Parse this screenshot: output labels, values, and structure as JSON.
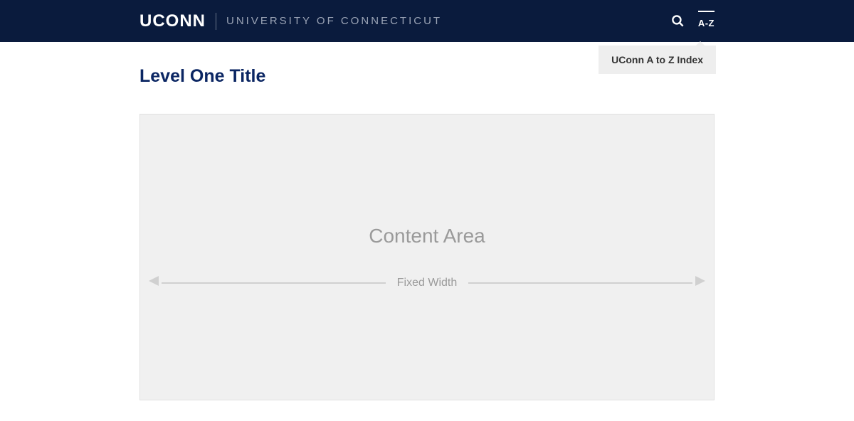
{
  "header": {
    "logo": "UCONN",
    "university_name": "UNIVERSITY OF CONNECTICUT",
    "az_label": "A-Z"
  },
  "tooltip": {
    "text": "UConn A to Z Index"
  },
  "page": {
    "title": "Level One Title"
  },
  "content_area": {
    "label": "Content Area",
    "width_label": "Fixed Width"
  }
}
